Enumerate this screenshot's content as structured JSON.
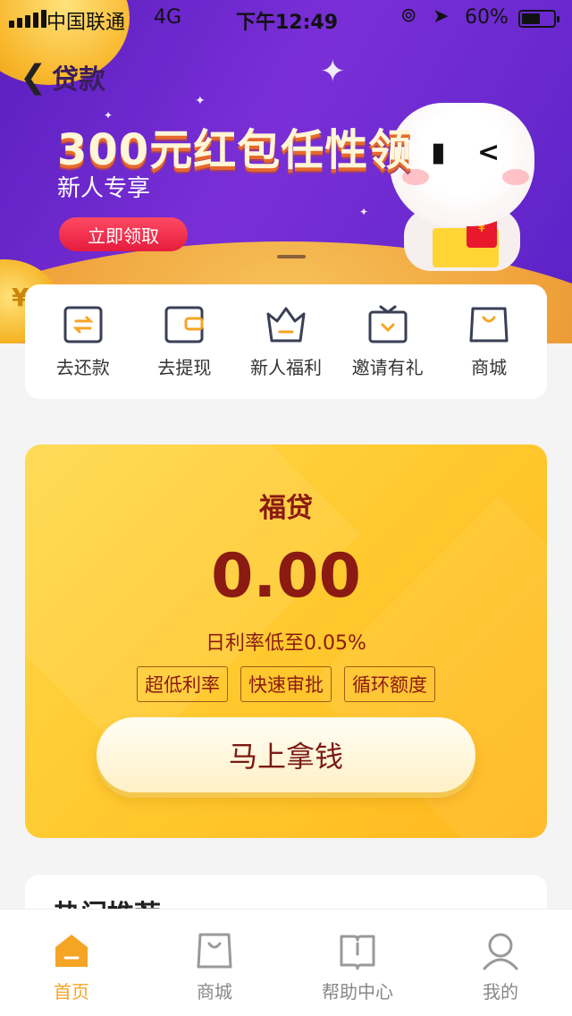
{
  "status_bar": {
    "carrier": "中国联通",
    "network": "4G",
    "time": "下午12:49",
    "battery": "60%"
  },
  "nav": {
    "back_icon": "chevron-left-icon",
    "title": "贷款"
  },
  "banner": {
    "title": "300元红包任性领",
    "subtitle": "新人专享",
    "button": "立即领取"
  },
  "quick_actions": [
    {
      "label": "去还款",
      "icon": "repay-icon"
    },
    {
      "label": "去提现",
      "icon": "wallet-icon"
    },
    {
      "label": "新人福利",
      "icon": "crown-icon"
    },
    {
      "label": "邀请有礼",
      "icon": "gift-icon"
    },
    {
      "label": "商城",
      "icon": "shopping-bag-icon"
    }
  ],
  "loan": {
    "name": "福贷",
    "amount": "0.00",
    "rate": "日利率低至0.05%",
    "tags": [
      "超低利率",
      "快速审批",
      "循环额度"
    ],
    "cta": "马上拿钱"
  },
  "recommend": {
    "title": "热门推荐"
  },
  "tabbar": {
    "items": [
      {
        "label": "首页",
        "icon": "home-icon",
        "active": true
      },
      {
        "label": "商城",
        "icon": "shopping-bag-icon",
        "active": false
      },
      {
        "label": "帮助中心",
        "icon": "book-icon",
        "active": false
      },
      {
        "label": "我的",
        "icon": "user-icon",
        "active": false
      }
    ]
  },
  "colors": {
    "accent": "#f5a524",
    "banner_purple": "#6c2ad0",
    "loan_yellow": "#ffc92e",
    "loan_text": "#8a1a12",
    "promo_button": "#e51c3e"
  }
}
